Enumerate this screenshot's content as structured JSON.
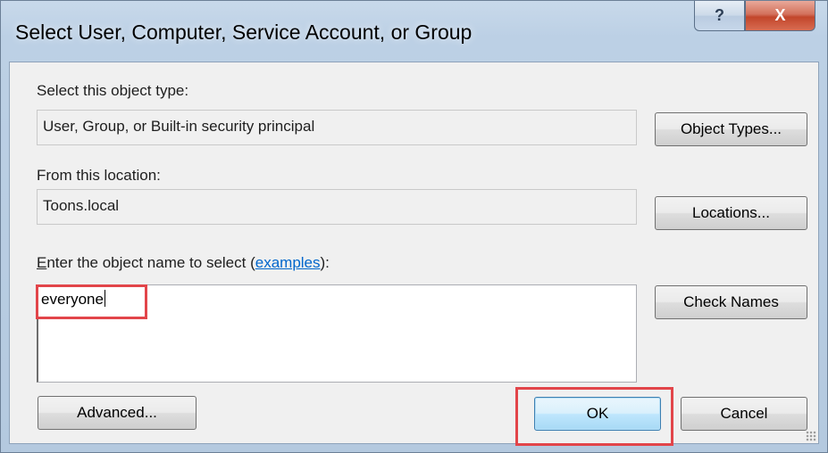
{
  "window": {
    "title": "Select User, Computer, Service Account, or Group",
    "help_glyph": "?",
    "close_glyph": "X"
  },
  "object_type": {
    "label": "Select this object type:",
    "value": "User, Group, or Built-in security principal",
    "button": "Object Types..."
  },
  "location": {
    "label": "From this location:",
    "value": "Toons.local",
    "button": "Locations..."
  },
  "object_name": {
    "label_prefix_mnemonic": "E",
    "label_prefix_rest": "nter the object name to select (",
    "label_link": "examples",
    "label_suffix": "):",
    "value": "everyone",
    "check_button": "Check Names"
  },
  "footer": {
    "advanced_button": "Advanced...",
    "ok_button": "OK",
    "cancel_button": "Cancel"
  },
  "colors": {
    "highlight": "#e2454a",
    "link": "#0066cc"
  }
}
